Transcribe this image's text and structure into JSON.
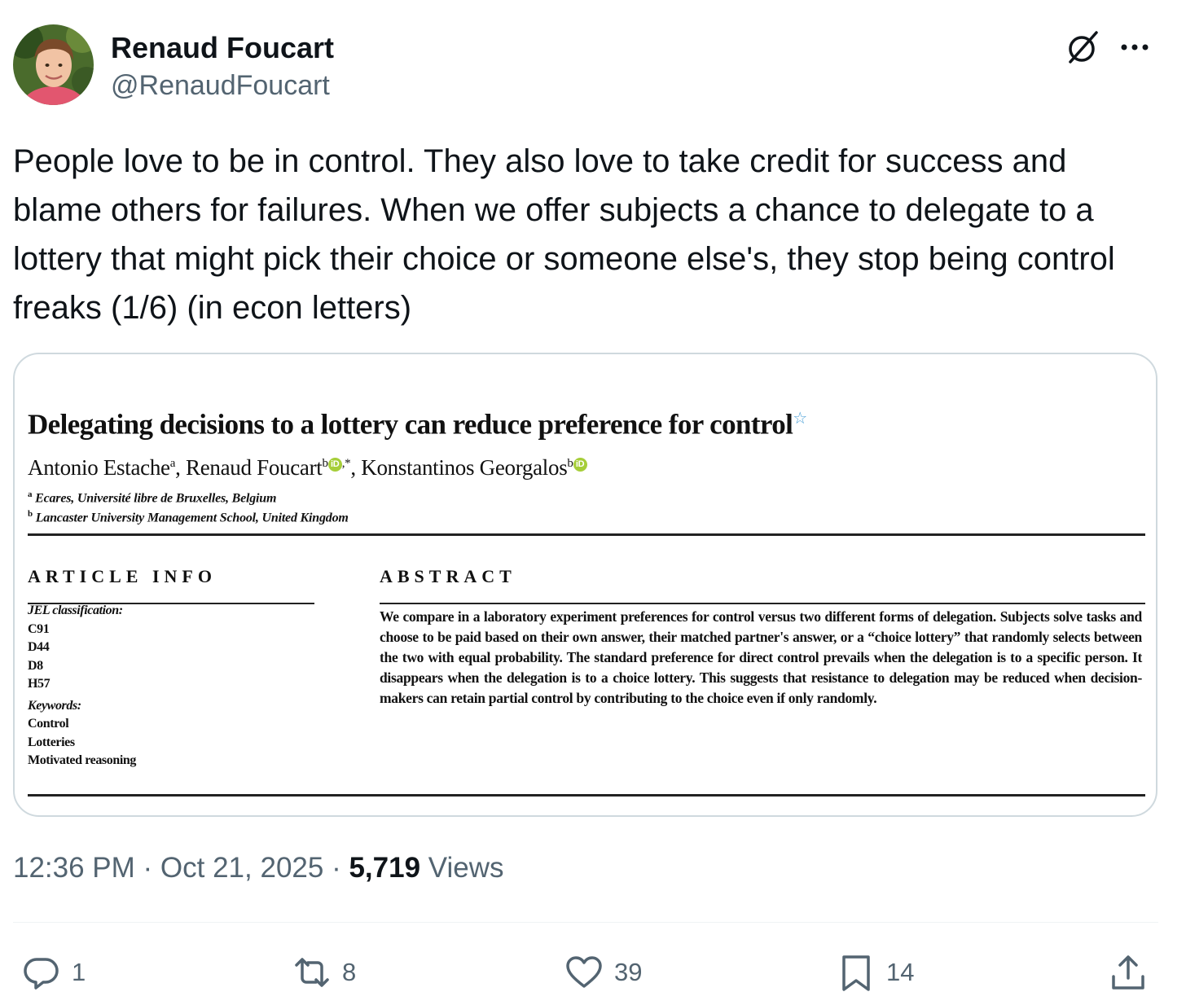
{
  "author": {
    "name": "Renaud Foucart",
    "handle": "@RenaudFoucart"
  },
  "tweet": {
    "text": "People love to be in control. They also love to take credit for success and blame others for failures. When we offer subjects a chance to delegate to a lottery that might pick their choice or someone else's, they stop being control freaks (1/6) (in econ letters)"
  },
  "paper": {
    "title": "Delegating decisions to a lottery can reduce preference for control",
    "title_mark": "☆",
    "authors": [
      {
        "name": "Antonio Estache",
        "sup": "a"
      },
      {
        "name": "Renaud Foucart",
        "sup": "b",
        "after": ",*"
      },
      {
        "name": "Konstantinos Georgalos",
        "sup": "b"
      }
    ],
    "author_sep": ", ",
    "orcid_label": "iD",
    "affiliations": [
      {
        "sup": "a",
        "text": "Ecares, Université libre de Bruxelles, Belgium"
      },
      {
        "sup": "b",
        "text": "Lancaster University Management School, United Kingdom"
      }
    ],
    "article_info_heading": "ARTICLE INFO",
    "abstract_heading": "ABSTRACT",
    "jel_label": "JEL classification:",
    "jel_codes": [
      "C91",
      "D44",
      "D8",
      "H57"
    ],
    "keywords_label": "Keywords:",
    "keywords": [
      "Control",
      "Lotteries",
      "Motivated reasoning"
    ],
    "abstract": "We compare in a laboratory experiment preferences for control versus two different forms of delegation. Subjects solve tasks and choose to be paid based on their own answer, their matched partner's answer, or a “choice lottery” that randomly selects between the two with equal probability. The standard preference for direct control prevails when the delegation is to a specific person. It disappears when the delegation is to a choice lottery. This suggests that resistance to delegation may be reduced when decision-makers can retain partial control by contributing to the choice even if only randomly."
  },
  "meta": {
    "time": "12:36 PM",
    "sep": " · ",
    "date": "Oct 21, 2025",
    "views_count": "5,719",
    "views_label": " Views"
  },
  "actions": {
    "replies": "1",
    "reposts": "8",
    "likes": "39",
    "bookmarks": "14"
  },
  "colors": {
    "text_primary": "#0f1419",
    "text_secondary": "#536471",
    "border": "#cfd9de",
    "orcid_green": "#a6ce39"
  },
  "icons": [
    "grok-icon",
    "more-icon",
    "reply-icon",
    "repost-icon",
    "like-icon",
    "bookmark-icon",
    "share-icon"
  ]
}
